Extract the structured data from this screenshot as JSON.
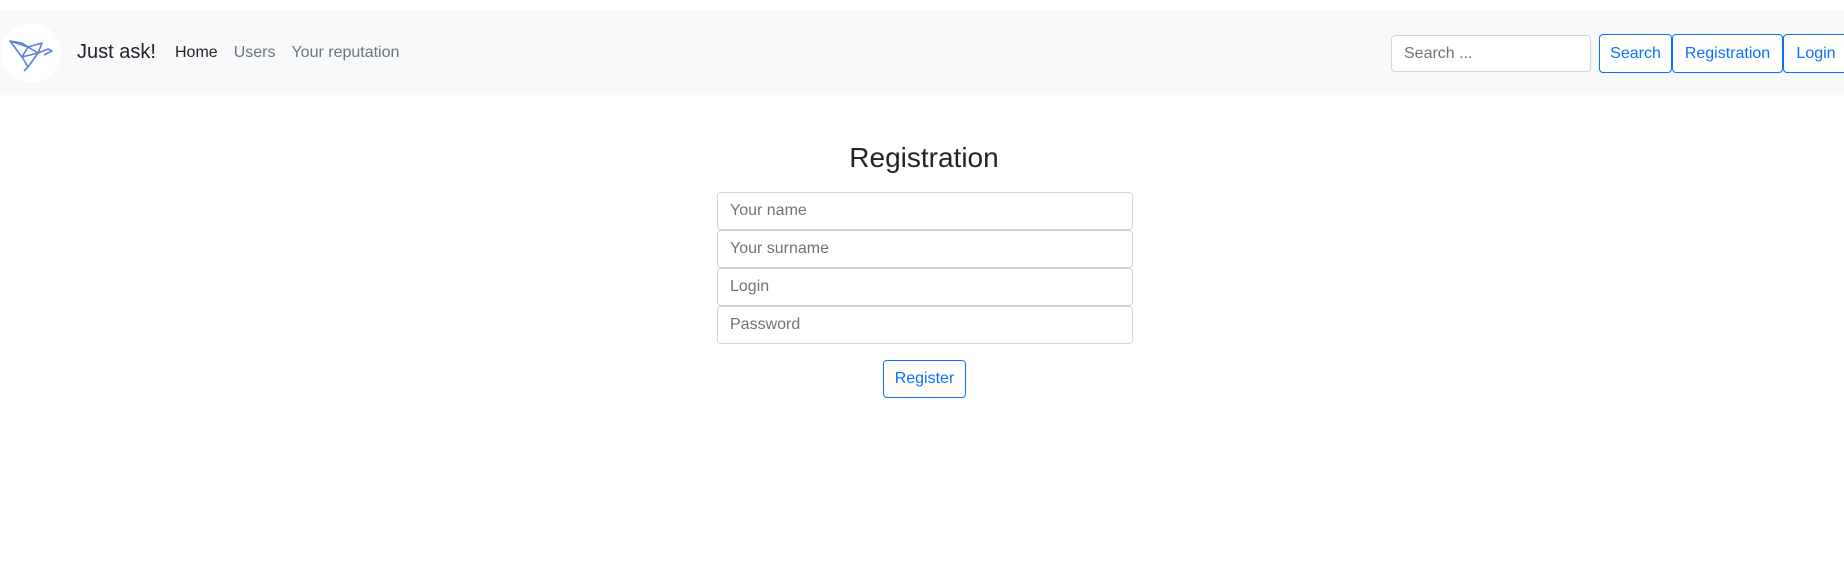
{
  "navbar": {
    "brand": "Just ask!",
    "logo_icon": "paper-bird-logo-icon",
    "links": [
      {
        "label": "Home",
        "active": true
      },
      {
        "label": "Users",
        "active": false
      },
      {
        "label": "Your reputation",
        "active": false
      }
    ],
    "search_placeholder": "Search ...",
    "search_button": "Search",
    "registration_button": "Registration",
    "login_button": "Login"
  },
  "form": {
    "title": "Registration",
    "name_placeholder": "Your name",
    "surname_placeholder": "Your surname",
    "login_placeholder": "Login",
    "password_placeholder": "Password",
    "submit_label": "Register"
  },
  "colors": {
    "navbar_bg": "#f8f9fa",
    "accent": "#0d6efd",
    "muted_text": "#6c757d",
    "logo_stroke": "#5b7fd6"
  }
}
